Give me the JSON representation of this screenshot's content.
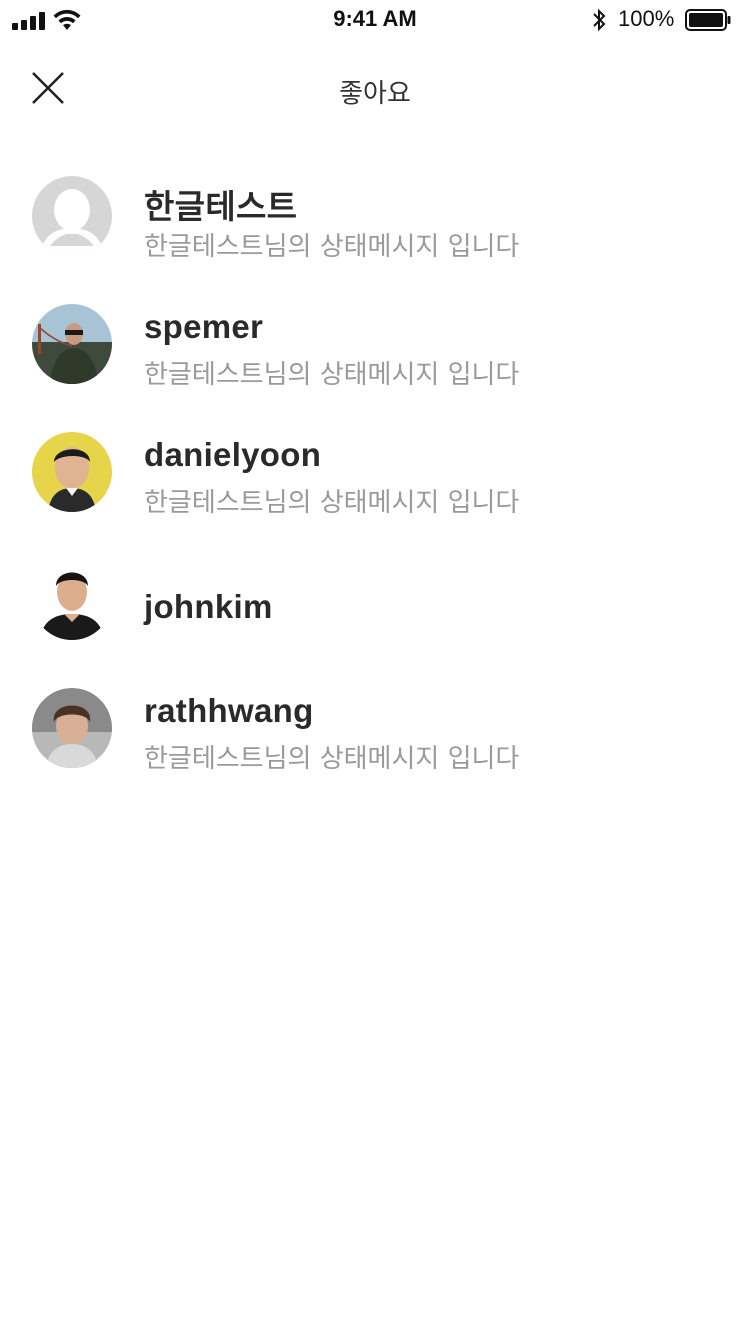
{
  "status_bar": {
    "time": "9:41 AM",
    "battery_percent": "100%",
    "icons": [
      "signal-icon",
      "wifi-icon",
      "bluetooth-icon",
      "battery-icon"
    ]
  },
  "header": {
    "title": "좋아요",
    "close_icon": "close-icon"
  },
  "users": [
    {
      "name": "한글테스트",
      "status": "한글테스트님의 상태메시지 입니다",
      "avatar": "default-avatar",
      "avatar_color": "#d6d6d6"
    },
    {
      "name": "spemer",
      "status": "한글테스트님의 상태메시지 입니다",
      "avatar": "photo-avatar",
      "avatar_color": "#6f8fa6"
    },
    {
      "name": "danielyoon",
      "status": "한글테스트님의 상태메시지 입니다",
      "avatar": "photo-avatar",
      "avatar_color": "#e6d44a"
    },
    {
      "name": "johnkim",
      "status": "",
      "avatar": "photo-avatar",
      "avatar_color": "#ffffff"
    },
    {
      "name": "rathhwang",
      "status": "한글테스트님의 상태메시지 입니다",
      "avatar": "photo-avatar",
      "avatar_color": "#8a8a8a"
    }
  ],
  "colors": {
    "name_text": "#2a2a2a",
    "status_text": "#9a9a9a",
    "background": "#ffffff"
  }
}
